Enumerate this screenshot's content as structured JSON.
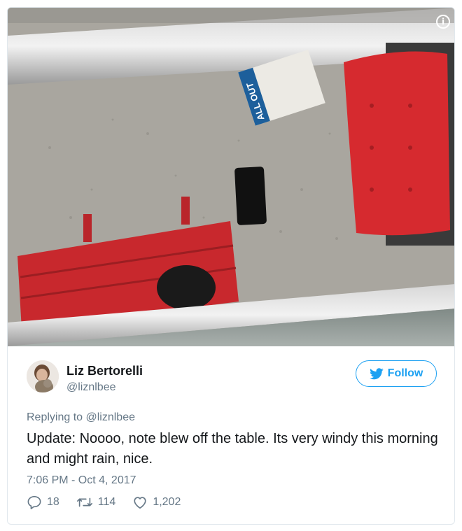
{
  "media": {
    "sign_text": "ALL OUT",
    "info_icon": "info-icon"
  },
  "author": {
    "name": "Liz Bertorelli",
    "handle": "@liznlbee"
  },
  "follow_button": {
    "label": "Follow",
    "icon": "twitter-bird-icon",
    "color": "#1da1f2"
  },
  "tweet": {
    "replying_to": "Replying to @liznlbee",
    "text": "Update: Noooo, note blew off the table. Its very windy this morning and might rain, nice.",
    "timestamp": "7:06 PM - Oct 4, 2017"
  },
  "actions": {
    "replies": "18",
    "retweets": "114",
    "likes": "1,202"
  }
}
